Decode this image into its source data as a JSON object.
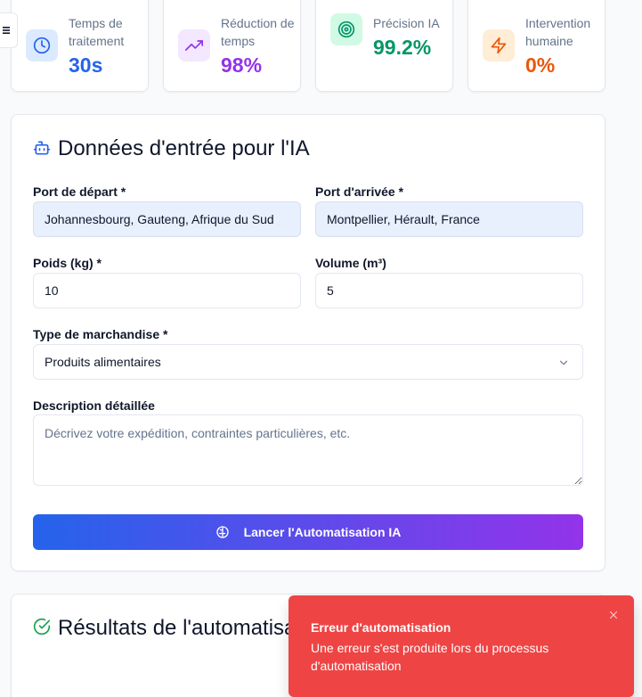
{
  "stats": [
    {
      "label": "Temps de traitement",
      "value": "30s",
      "icon": "clock-icon",
      "color": "#2563eb",
      "bg": "#dbeafe"
    },
    {
      "label": "Réduction de temps",
      "value": "98%",
      "icon": "trending-up-icon",
      "color": "#9333ea",
      "bg": "#f3e8ff"
    },
    {
      "label": "Précision IA",
      "value": "99.2%",
      "icon": "target-icon",
      "color": "#059669",
      "bg": "#d1fae5"
    },
    {
      "label": "Intervention humaine",
      "value": "0%",
      "icon": "zap-icon",
      "color": "#ea580c",
      "bg": "#ffedd5"
    }
  ],
  "form": {
    "title": "Données d'entrée pour l'IA",
    "departure_label": "Port de départ *",
    "departure_value": "Johannesbourg, Gauteng, Afrique du Sud",
    "arrival_label": "Port d'arrivée *",
    "arrival_value": "Montpellier, Hérault, France",
    "weight_label": "Poids (kg) *",
    "weight_value": "10",
    "volume_label": "Volume (m³)",
    "volume_value": "5",
    "goods_type_label": "Type de marchandise *",
    "goods_type_value": "Produits alimentaires",
    "description_label": "Description détaillée",
    "description_placeholder": "Décrivez votre expédition, contraintes particulières, etc.",
    "launch_label": "Lancer l'Automatisation IA"
  },
  "results": {
    "title": "Résultats de l'automatisation"
  },
  "toast": {
    "title": "Erreur d'automatisation",
    "message": "Une erreur s'est produite lors du processus d'automatisation"
  },
  "colors": {
    "accent_blue": "#2563eb",
    "accent_purple": "#9333ea",
    "error_red": "#ef4444",
    "success_green": "#16a34a"
  }
}
